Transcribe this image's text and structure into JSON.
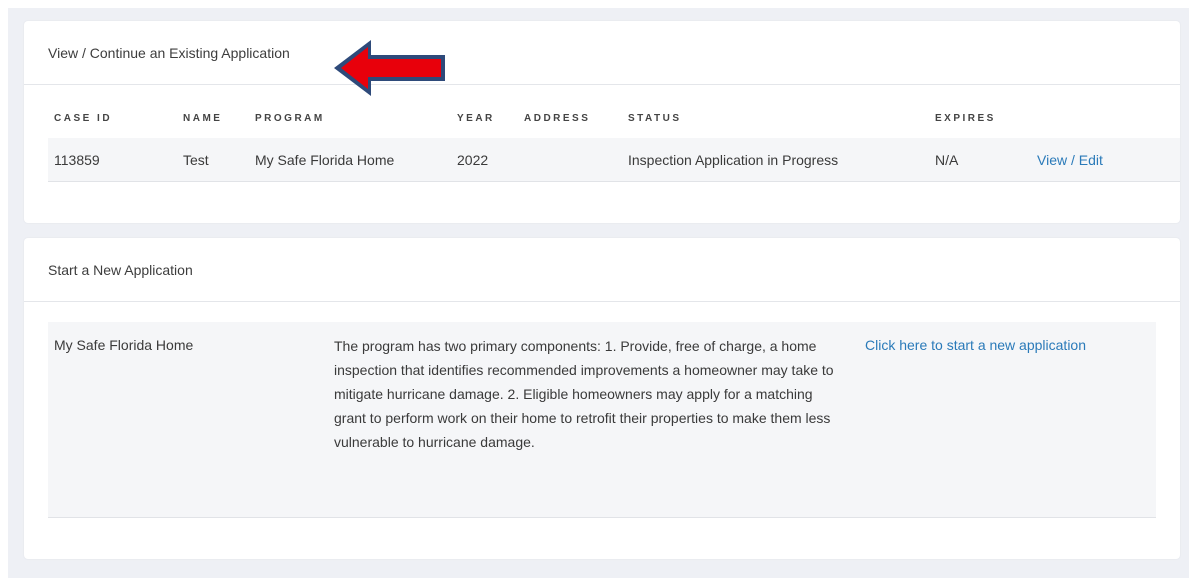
{
  "existing": {
    "title": "View / Continue an Existing Application",
    "columns": [
      "CASE ID",
      "NAME",
      "PROGRAM",
      "YEAR",
      "ADDRESS",
      "STATUS",
      "EXPIRES",
      ""
    ],
    "rows": [
      {
        "case_id": "113859",
        "name": "Test",
        "program": "My Safe Florida Home",
        "year": "2022",
        "address": "",
        "status": "Inspection Application in Progress",
        "expires": "N/A",
        "action": "View / Edit"
      }
    ]
  },
  "new_app": {
    "title": "Start a New Application",
    "program": "My Safe Florida Home",
    "description": "The program has two primary components: 1. Provide, free of charge, a home inspection that identifies recommended improvements a homeowner may take to mitigate hurricane damage. 2. Eligible homeowners may apply for a matching grant to perform work on their home to retrofit their properties to make them less vulnerable to hurricane damage.",
    "link": "Click here to start a new application"
  },
  "colors": {
    "accent_link": "#2a7ab9",
    "arrow_fill": "#e8000b",
    "arrow_outline": "#2e4a7a",
    "page_bg": "#eef0f5"
  }
}
